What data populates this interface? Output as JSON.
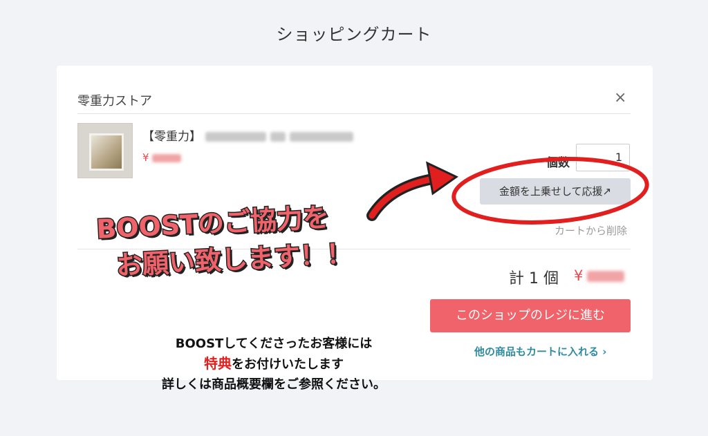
{
  "page_title": "ショッピングカート",
  "store": {
    "name": "零重力ストア",
    "close_label": "×"
  },
  "item": {
    "name_prefix": "【零重力】",
    "price_currency": "¥",
    "quantity_label": "個数",
    "quantity": "1",
    "boost_label": "金額を上乗せして応援↗",
    "remove_label": "カートから削除"
  },
  "summary": {
    "total_label": "計 1 個",
    "total_currency": "¥",
    "checkout_label": "このショップのレジに進む",
    "continue_label": "他の商品もカートに入れる ›"
  },
  "overlay": {
    "banner_line1": "BOOSTのご協力を",
    "banner_line2": "お願い致します！！",
    "notice_line1": "BOOSTしてくださったお客様には",
    "notice_highlight": "特典",
    "notice_line2_rest": "をお付けいたします",
    "notice_line3": "詳しくは商品概要欄をご参照ください。"
  },
  "colors": {
    "accent": "#f0636a",
    "price": "#e8484d",
    "link": "#2f8ba0",
    "annotation": "#e21f1f"
  }
}
